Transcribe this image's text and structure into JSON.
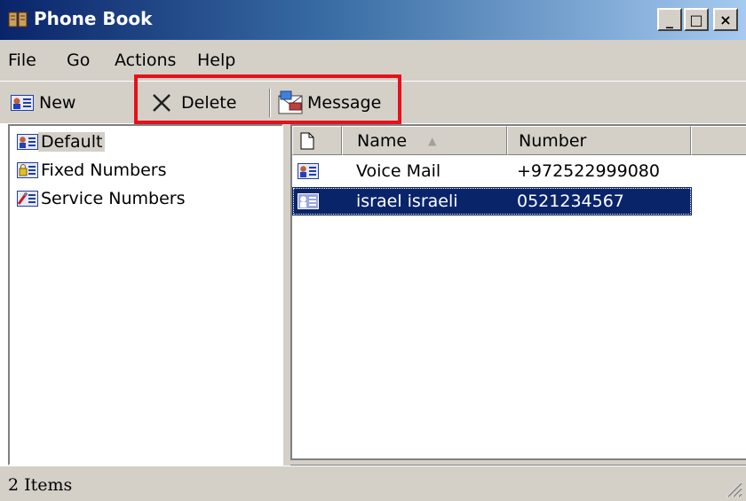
{
  "window": {
    "title": "Phone Book",
    "minimize_label": "_",
    "maximize_label": "□",
    "close_label": "×"
  },
  "menu": {
    "items": [
      "File",
      "Go",
      "Actions",
      "Help"
    ]
  },
  "toolbar": {
    "new_label": "New",
    "delete_label": "Delete",
    "message_label": "Message"
  },
  "tree": {
    "items": [
      {
        "label": "Default",
        "icon": "contact-card-icon",
        "selected": true
      },
      {
        "label": "Fixed Numbers",
        "icon": "locked-card-icon",
        "selected": false
      },
      {
        "label": "Service Numbers",
        "icon": "service-card-icon",
        "selected": false
      }
    ]
  },
  "list": {
    "columns": [
      "",
      "Name",
      "Number",
      ""
    ],
    "sort_column": "Name",
    "rows": [
      {
        "name": "Voice Mail",
        "number": "+972522999080",
        "icon": "contact-card-icon",
        "selected": false
      },
      {
        "name": "israel israeli",
        "number": "0521234567",
        "icon": "contact-card-icon",
        "selected": true
      }
    ]
  },
  "status": {
    "text": "2 Items"
  },
  "colors": {
    "highlight_box": "#e8101a",
    "selection": "#0a246a",
    "face": "#d4d0c8"
  }
}
